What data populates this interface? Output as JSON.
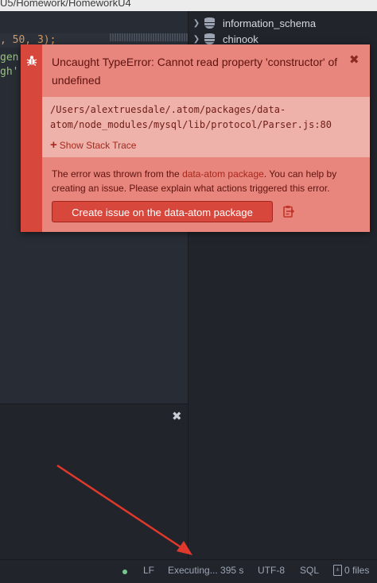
{
  "window": {
    "title": "U5/Homework/HomeworkU4"
  },
  "editor": {
    "lines": [
      ", 50, 3);",
      "gen",
      "gh'"
    ]
  },
  "tree": {
    "items": [
      {
        "label": "information_schema",
        "icon": "database-icon"
      },
      {
        "label": "chinook",
        "icon": "database-icon"
      }
    ]
  },
  "notification": {
    "title": "Uncaught TypeError: Cannot read property 'constructor' of undefined",
    "path": "/Users/alextruesdale/.atom/packages/data-atom/node_modules/mysql/lib/protocol/Parser.js:80",
    "stack_trace_label": "Show Stack Trace",
    "description_before": "The error was thrown from the ",
    "package_link": "data-atom package",
    "description_after": ". You can help by creating an issue. Please explain what actions triggered this error.",
    "issue_button": "Create issue on the data-atom package",
    "colors": {
      "strip": "#d8473b",
      "background": "#e8867d",
      "detail": "#efb2ab"
    }
  },
  "statusbar": {
    "line_ending": "LF",
    "executing": "Executing... 395 s",
    "encoding": "UTF-8",
    "grammar": "SQL",
    "files": "0 files",
    "status_color": "#73c990"
  },
  "annotation": {
    "arrow_color": "#e0382c"
  }
}
